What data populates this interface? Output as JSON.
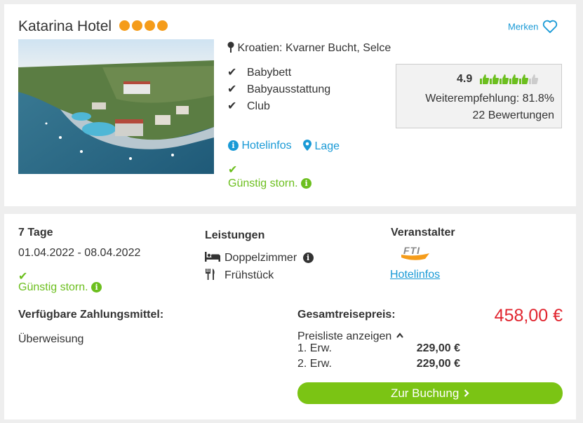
{
  "hotel": {
    "name": "Katarina Hotel",
    "stars": 4,
    "merken_label": "Merken",
    "location": "Kroatien: Kvarner Bucht, Selce",
    "features": [
      "Babybett",
      "Babyausstattung",
      "Club"
    ],
    "links": {
      "hotelinfos": "Hotelinfos",
      "lage": "Lage"
    },
    "cancel_label": "Günstig storn."
  },
  "rating": {
    "score": "4.9",
    "thumbs": 6,
    "thumbs_filled": 5,
    "recommendation": "Weiterempfehlung: 81.8%",
    "reviews": "22 Bewertungen"
  },
  "offer": {
    "duration": "7 Tage",
    "dates": "01.04.2022 - 08.04.2022",
    "cancel_label": "Günstig storn.",
    "services_title": "Leistungen",
    "room": "Doppelzimmer",
    "board": "Frühstück",
    "operator_title": "Veranstalter",
    "operator_logo": "FTI",
    "operator_link": "Hotelinfos",
    "payment_title": "Verfügbare Zahlungsmittel:",
    "payment_method": "Überweisung",
    "total_label": "Gesamtreisepreis:",
    "total_price": "458,00 €",
    "pricelist_toggle": "Preisliste anzeigen",
    "price_rows": [
      {
        "label": "1. Erw.",
        "price": "229,00 €"
      },
      {
        "label": "2. Erw.",
        "price": "229,00 €"
      }
    ],
    "book_button": "Zur Buchung"
  },
  "colors": {
    "accent_blue": "#1a9ad6",
    "green": "#6cbf1e",
    "price_red": "#e1252f",
    "star_orange": "#f59c1a",
    "button_green": "#7bc414"
  }
}
